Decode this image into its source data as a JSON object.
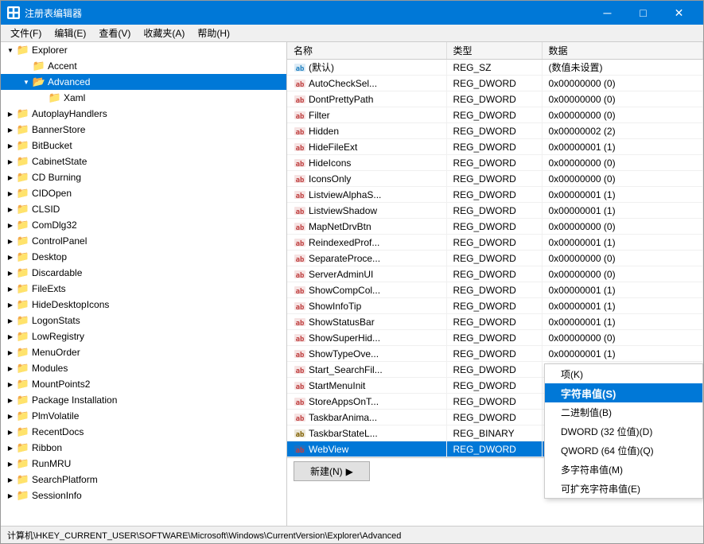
{
  "window": {
    "title": "注册表编辑器",
    "icon": "🗂"
  },
  "title_buttons": {
    "minimize": "─",
    "maximize": "□",
    "close": "✕"
  },
  "menu": {
    "items": [
      "文件(F)",
      "编辑(E)",
      "查看(V)",
      "收藏夹(A)",
      "帮助(H)"
    ]
  },
  "tree": {
    "items": [
      {
        "label": "Explorer",
        "level": 1,
        "expanded": true,
        "selected": false
      },
      {
        "label": "Accent",
        "level": 2,
        "expanded": false,
        "selected": false
      },
      {
        "label": "Advanced",
        "level": 2,
        "expanded": true,
        "selected": true
      },
      {
        "label": "Xaml",
        "level": 3,
        "expanded": false,
        "selected": false
      },
      {
        "label": "AutoplayHandlers",
        "level": 1,
        "expanded": false,
        "selected": false
      },
      {
        "label": "BannerStore",
        "level": 1,
        "expanded": false,
        "selected": false
      },
      {
        "label": "BitBucket",
        "level": 1,
        "expanded": false,
        "selected": false
      },
      {
        "label": "CabinetState",
        "level": 1,
        "expanded": false,
        "selected": false
      },
      {
        "label": "CD Burning",
        "level": 1,
        "expanded": false,
        "selected": false
      },
      {
        "label": "CIDOpen",
        "level": 1,
        "expanded": false,
        "selected": false
      },
      {
        "label": "CLSID",
        "level": 1,
        "expanded": false,
        "selected": false
      },
      {
        "label": "ComDlg32",
        "level": 1,
        "expanded": false,
        "selected": false
      },
      {
        "label": "ControlPanel",
        "level": 1,
        "expanded": false,
        "selected": false
      },
      {
        "label": "Desktop",
        "level": 1,
        "expanded": false,
        "selected": false
      },
      {
        "label": "Discardable",
        "level": 1,
        "expanded": false,
        "selected": false
      },
      {
        "label": "FileExts",
        "level": 1,
        "expanded": false,
        "selected": false
      },
      {
        "label": "HideDesktopIcons",
        "level": 1,
        "expanded": false,
        "selected": false
      },
      {
        "label": "LogonStats",
        "level": 1,
        "expanded": false,
        "selected": false
      },
      {
        "label": "LowRegistry",
        "level": 1,
        "expanded": false,
        "selected": false
      },
      {
        "label": "MenuOrder",
        "level": 1,
        "expanded": false,
        "selected": false
      },
      {
        "label": "Modules",
        "level": 1,
        "expanded": false,
        "selected": false
      },
      {
        "label": "MountPoints2",
        "level": 1,
        "expanded": false,
        "selected": false
      },
      {
        "label": "Package Installation",
        "level": 1,
        "expanded": false,
        "selected": false
      },
      {
        "label": "PlmVolatile",
        "level": 1,
        "expanded": false,
        "selected": false
      },
      {
        "label": "RecentDocs",
        "level": 1,
        "expanded": false,
        "selected": false
      },
      {
        "label": "Ribbon",
        "level": 1,
        "expanded": false,
        "selected": false
      },
      {
        "label": "RunMRU",
        "level": 1,
        "expanded": false,
        "selected": false
      },
      {
        "label": "SearchPlatform",
        "level": 1,
        "expanded": false,
        "selected": false
      },
      {
        "label": "SessionInfo",
        "level": 1,
        "expanded": false,
        "selected": false
      }
    ]
  },
  "registry": {
    "columns": [
      "名称",
      "类型",
      "数据"
    ],
    "rows": [
      {
        "name": "(默认)",
        "type": "REG_SZ",
        "data": "(数值未设置)"
      },
      {
        "name": "AutoCheckSel...",
        "type": "REG_DWORD",
        "data": "0x00000000 (0)"
      },
      {
        "name": "DontPrettyPath",
        "type": "REG_DWORD",
        "data": "0x00000000 (0)"
      },
      {
        "name": "Filter",
        "type": "REG_DWORD",
        "data": "0x00000000 (0)"
      },
      {
        "name": "Hidden",
        "type": "REG_DWORD",
        "data": "0x00000002 (2)"
      },
      {
        "name": "HideFileExt",
        "type": "REG_DWORD",
        "data": "0x00000001 (1)"
      },
      {
        "name": "HideIcons",
        "type": "REG_DWORD",
        "data": "0x00000000 (0)"
      },
      {
        "name": "IconsOnly",
        "type": "REG_DWORD",
        "data": "0x00000000 (0)"
      },
      {
        "name": "ListviewAlphaS...",
        "type": "REG_DWORD",
        "data": "0x00000001 (1)"
      },
      {
        "name": "ListviewShadow",
        "type": "REG_DWORD",
        "data": "0x00000001 (1)"
      },
      {
        "name": "MapNetDrvBtn",
        "type": "REG_DWORD",
        "data": "0x00000000 (0)"
      },
      {
        "name": "ReindexedProf...",
        "type": "REG_DWORD",
        "data": "0x00000001 (1)"
      },
      {
        "name": "SeparateProce...",
        "type": "REG_DWORD",
        "data": "0x00000000 (0)"
      },
      {
        "name": "ServerAdminUI",
        "type": "REG_DWORD",
        "data": "0x00000000 (0)"
      },
      {
        "name": "ShowCompCol...",
        "type": "REG_DWORD",
        "data": "0x00000001 (1)"
      },
      {
        "name": "ShowInfoTip",
        "type": "REG_DWORD",
        "data": "0x00000001 (1)"
      },
      {
        "name": "ShowStatusBar",
        "type": "REG_DWORD",
        "data": "0x00000001 (1)"
      },
      {
        "name": "ShowSuperHid...",
        "type": "REG_DWORD",
        "data": "0x00000000 (0)"
      },
      {
        "name": "ShowTypeOve...",
        "type": "REG_DWORD",
        "data": "0x00000001 (1)"
      },
      {
        "name": "Start_SearchFil...",
        "type": "REG_DWORD",
        "data": ""
      },
      {
        "name": "StartMenuInit",
        "type": "REG_DWORD",
        "data": ""
      },
      {
        "name": "StoreAppsOnT...",
        "type": "REG_DWORD",
        "data": ""
      },
      {
        "name": "TaskbarAnima...",
        "type": "REG_DWORD",
        "data": ""
      },
      {
        "name": "TaskbarStateL...",
        "type": "REG_BINARY",
        "data": ""
      },
      {
        "name": "WebView",
        "type": "REG_DWORD",
        "data": ""
      }
    ]
  },
  "context_menu": {
    "items": [
      {
        "label": "项(K)",
        "highlighted": false
      },
      {
        "label": "字符串值(S)",
        "highlighted": true
      },
      {
        "label": "二进制值(B)",
        "highlighted": false
      },
      {
        "label": "DWORD (32 位值)(D)",
        "highlighted": false
      },
      {
        "label": "QWORD (64 位值)(Q)",
        "highlighted": false
      },
      {
        "label": "多字符串值(M)",
        "highlighted": false
      },
      {
        "label": "可扩充字符串值(E)",
        "highlighted": false
      }
    ]
  },
  "new_button": {
    "label": "新建(N)",
    "arrow": "▶"
  },
  "status_bar": {
    "text": "计算机\\HKEY_CURRENT_USER\\SOFTWARE\\Microsoft\\Windows\\CurrentVersion\\Explorer\\Advanced"
  }
}
